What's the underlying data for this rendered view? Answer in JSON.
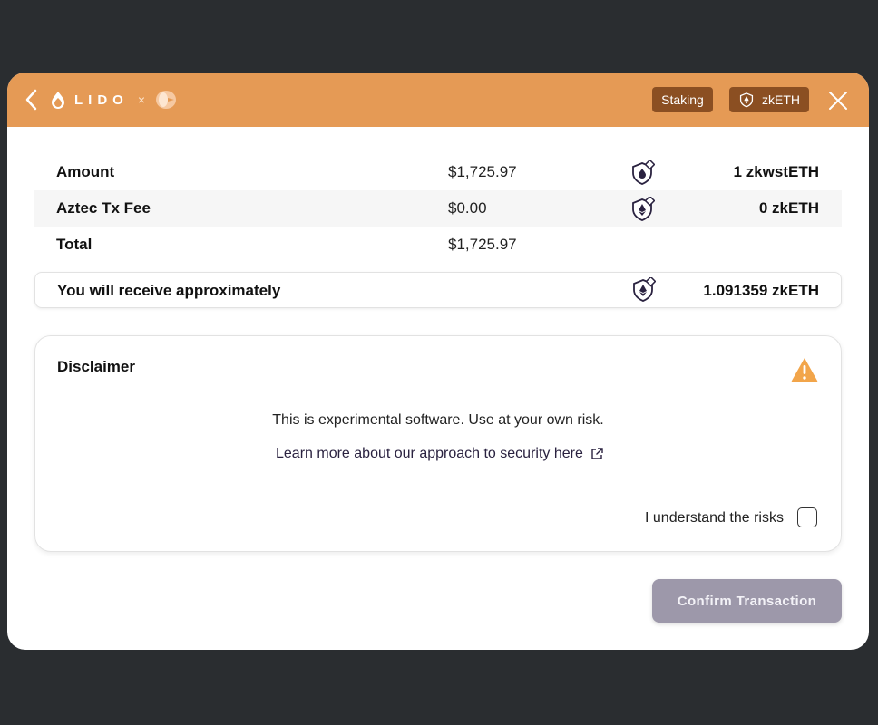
{
  "header": {
    "brand": "LIDO",
    "separator": "×",
    "badges": {
      "staking": "Staking",
      "token": "zkETH"
    }
  },
  "summary": {
    "rows": [
      {
        "label": "Amount",
        "usd": "$1,725.97",
        "amount": "1 zkwstETH",
        "icon": "zkwsteth-shield-icon"
      },
      {
        "label": "Aztec Tx Fee",
        "usd": "$0.00",
        "amount": "0 zkETH",
        "icon": "zketh-shield-icon"
      },
      {
        "label": "Total",
        "usd": "$1,725.97"
      }
    ],
    "receive": {
      "label": "You will receive approximately",
      "amount": "1.091359 zkETH"
    }
  },
  "disclaimer": {
    "title": "Disclaimer",
    "text": "This is experimental software. Use at your own risk.",
    "link": "Learn more about our approach to security here",
    "checkbox_label": "I understand the risks",
    "checked": false
  },
  "actions": {
    "confirm": "Confirm Transaction"
  },
  "colors": {
    "header": "#e59a55",
    "badge": "#8b4f22",
    "confirm_disabled": "#9d98aa",
    "warning": "#f2a54a"
  }
}
